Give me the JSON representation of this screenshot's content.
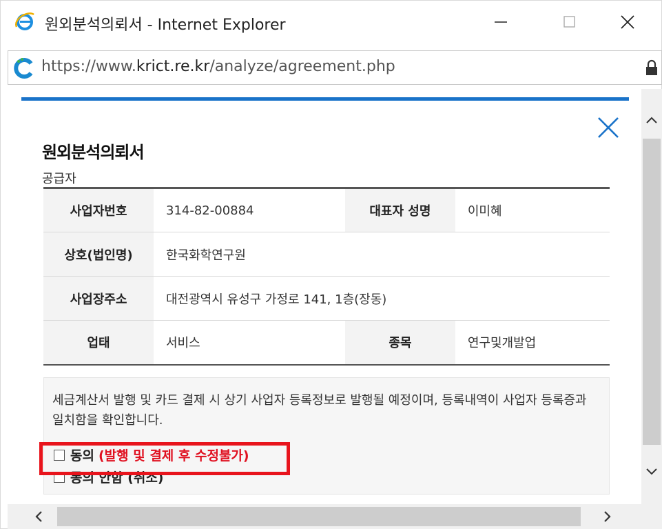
{
  "window": {
    "title": "원외분석의뢰서 - Internet Explorer",
    "icons": {
      "app": "internet-explorer-icon",
      "minimize": "minimize-icon",
      "maximize": "maximize-icon",
      "close": "close-icon"
    }
  },
  "address": {
    "scheme": "https://",
    "host_prefix": "www.",
    "host_main": "krict.re.kr",
    "path": "/analyze/agreement.php",
    "icons": {
      "site": "site-favicon-icon",
      "lock": "lock-icon"
    }
  },
  "colors": {
    "accent_rule": "#1a73c9",
    "close_x": "#1a73c9",
    "warning": "#e01020",
    "highlight": "#e8141c"
  },
  "document": {
    "title": "원외분석의뢰서",
    "section_label": "공급자",
    "rows": [
      {
        "label": "사업자번호",
        "value": "314-82-00884",
        "label2": "대표자 성명",
        "value2": "이미혜"
      },
      {
        "label": "상호(법인명)",
        "value": "한국화학연구원"
      },
      {
        "label": "사업장주소",
        "value": "대전광역시 유성구 가정로 141, 1층(장동)"
      },
      {
        "label": "업태",
        "value": "서비스",
        "label2": "종목",
        "value2": "연구및개발업"
      }
    ],
    "notice": "세금계산서 발행 및 카드 결제 시 상기 사업자 등록정보로 발행될 예정이며, 등록내역이 사업자 등록증과 일치함을 확인합니다.",
    "agree_label": "동의",
    "agree_warning": "(발행 및 결제 후 수정불가)",
    "disagree_label": "동의 안함 (취소)"
  }
}
